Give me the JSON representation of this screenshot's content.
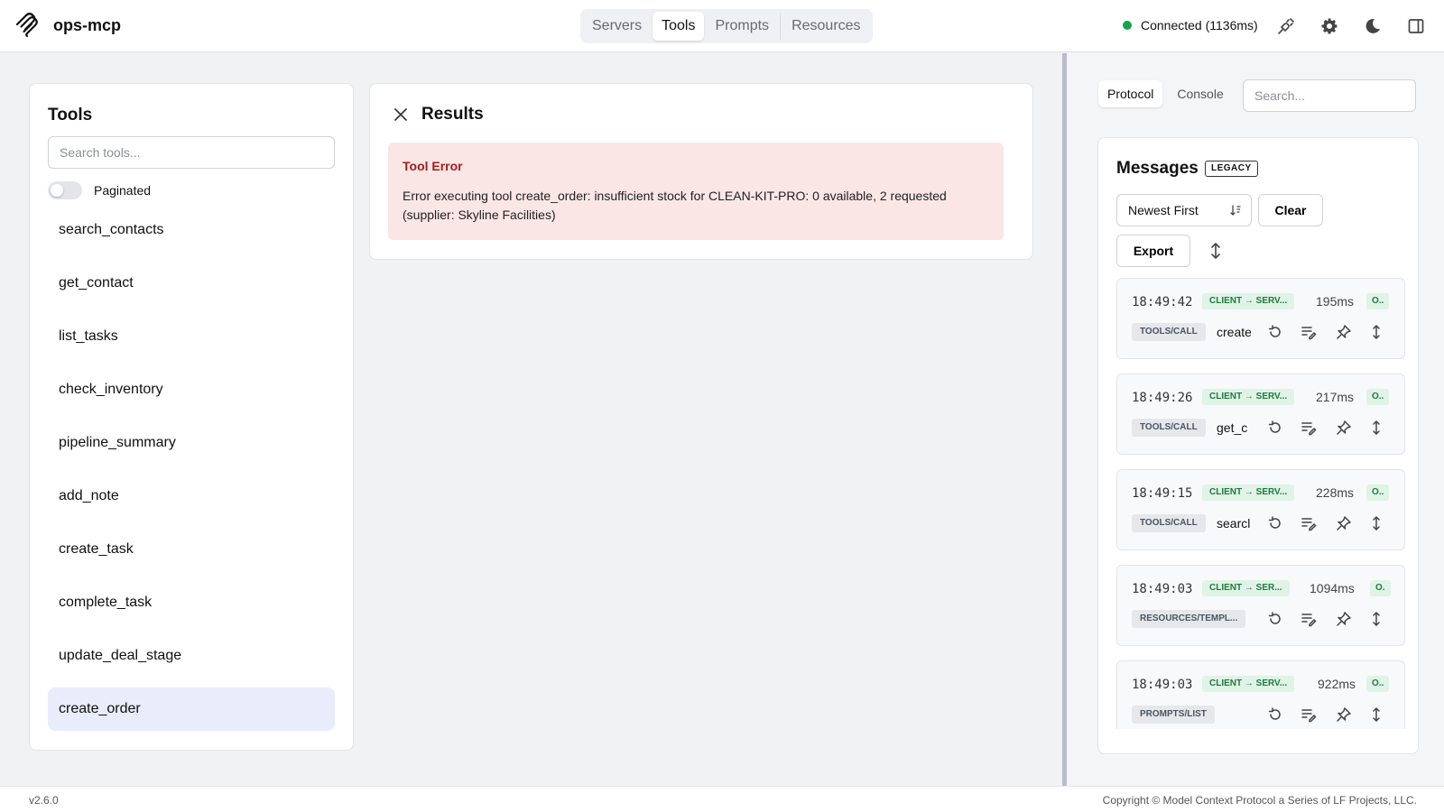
{
  "header": {
    "app_title": "ops-mcp",
    "nav_tabs": [
      "Servers",
      "Tools",
      "Prompts",
      "Resources"
    ],
    "active_tab": "Tools",
    "status_text": "Connected (1136ms)"
  },
  "tools_panel": {
    "title": "Tools",
    "search_placeholder": "Search tools...",
    "paginated_label": "Paginated",
    "tools": [
      "search_contacts",
      "get_contact",
      "list_tasks",
      "check_inventory",
      "pipeline_summary",
      "add_note",
      "create_task",
      "complete_task",
      "update_deal_stage",
      "create_order"
    ],
    "selected_tool": "create_order"
  },
  "results_panel": {
    "title": "Results",
    "error_title": "Tool Error",
    "error_message": "Error executing tool create_order: insufficient stock for CLEAN-KIT-PRO: 0 available, 2 requested (supplier: Skyline Facilities)"
  },
  "right_panel": {
    "tabs": [
      "Protocol",
      "Console"
    ],
    "active_tab": "Protocol",
    "search_placeholder": "Search...",
    "messages_title": "Messages",
    "legacy_badge": "LEGACY",
    "sort_label": "Newest First",
    "clear_label": "Clear",
    "export_label": "Export",
    "messages": [
      {
        "time": "18:49:42",
        "direction": "CLIENT → SERV...",
        "duration": "195ms",
        "status": "O..",
        "method": "TOOLS/CALL",
        "name": "create"
      },
      {
        "time": "18:49:26",
        "direction": "CLIENT → SERV...",
        "duration": "217ms",
        "status": "O..",
        "method": "TOOLS/CALL",
        "name": "get_c"
      },
      {
        "time": "18:49:15",
        "direction": "CLIENT → SERV...",
        "duration": "228ms",
        "status": "O..",
        "method": "TOOLS/CALL",
        "name": "searcl"
      },
      {
        "time": "18:49:03",
        "direction": "CLIENT → SER...",
        "duration": "1094ms",
        "status": "O.",
        "method": "RESOURCES/TEMPL...",
        "name": ""
      },
      {
        "time": "18:49:03",
        "direction": "CLIENT → SERV...",
        "duration": "922ms",
        "status": "O..",
        "method": "PROMPTS/LIST",
        "name": ""
      }
    ]
  },
  "footer": {
    "version": "v2.6.0",
    "copyright": "Copyright © Model Context Protocol a Series of LF Projects, LLC."
  },
  "colors": {
    "connected": "#16a34a",
    "error_bg": "#fbe6e6",
    "error_text": "#a31d1d",
    "selected_tool_bg": "#e8ecfb"
  }
}
